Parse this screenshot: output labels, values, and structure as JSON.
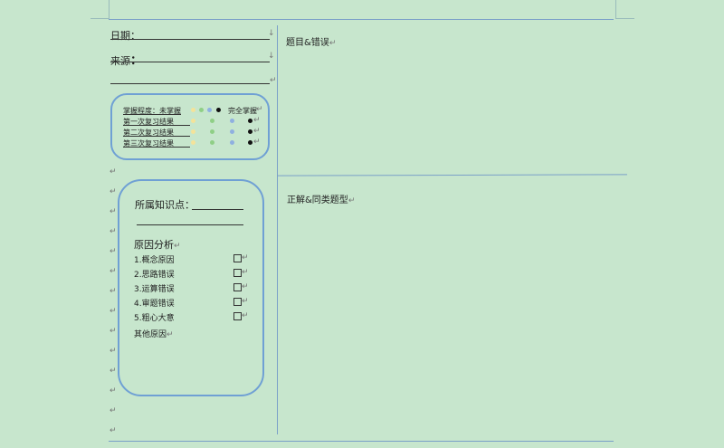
{
  "header": {
    "date_label": "日期：",
    "source_label": "来源",
    "source_colon": "："
  },
  "mastery": {
    "label": "掌握程度：",
    "low": "未掌握",
    "high": "完全掌握",
    "reviews": [
      "第一次复习结果",
      "第二次复习结果",
      "第三次复习结果"
    ],
    "dot_colors": [
      "#f4e39a",
      "#8fcf86",
      "#8fb0e0",
      "#111111"
    ]
  },
  "analysis": {
    "knowledge_label": "所属知识点：",
    "reason_title": "原因分析",
    "reasons": [
      "1.概念原因",
      "2.思路错误",
      "3.运算错误",
      "4.审题错误",
      "5.粗心大意"
    ],
    "other": "其他原因"
  },
  "right": {
    "question_title": "题目&错误",
    "correction_title": "正解&同类题型"
  },
  "marks": {
    "para": "↵",
    "arrow": "↓"
  }
}
